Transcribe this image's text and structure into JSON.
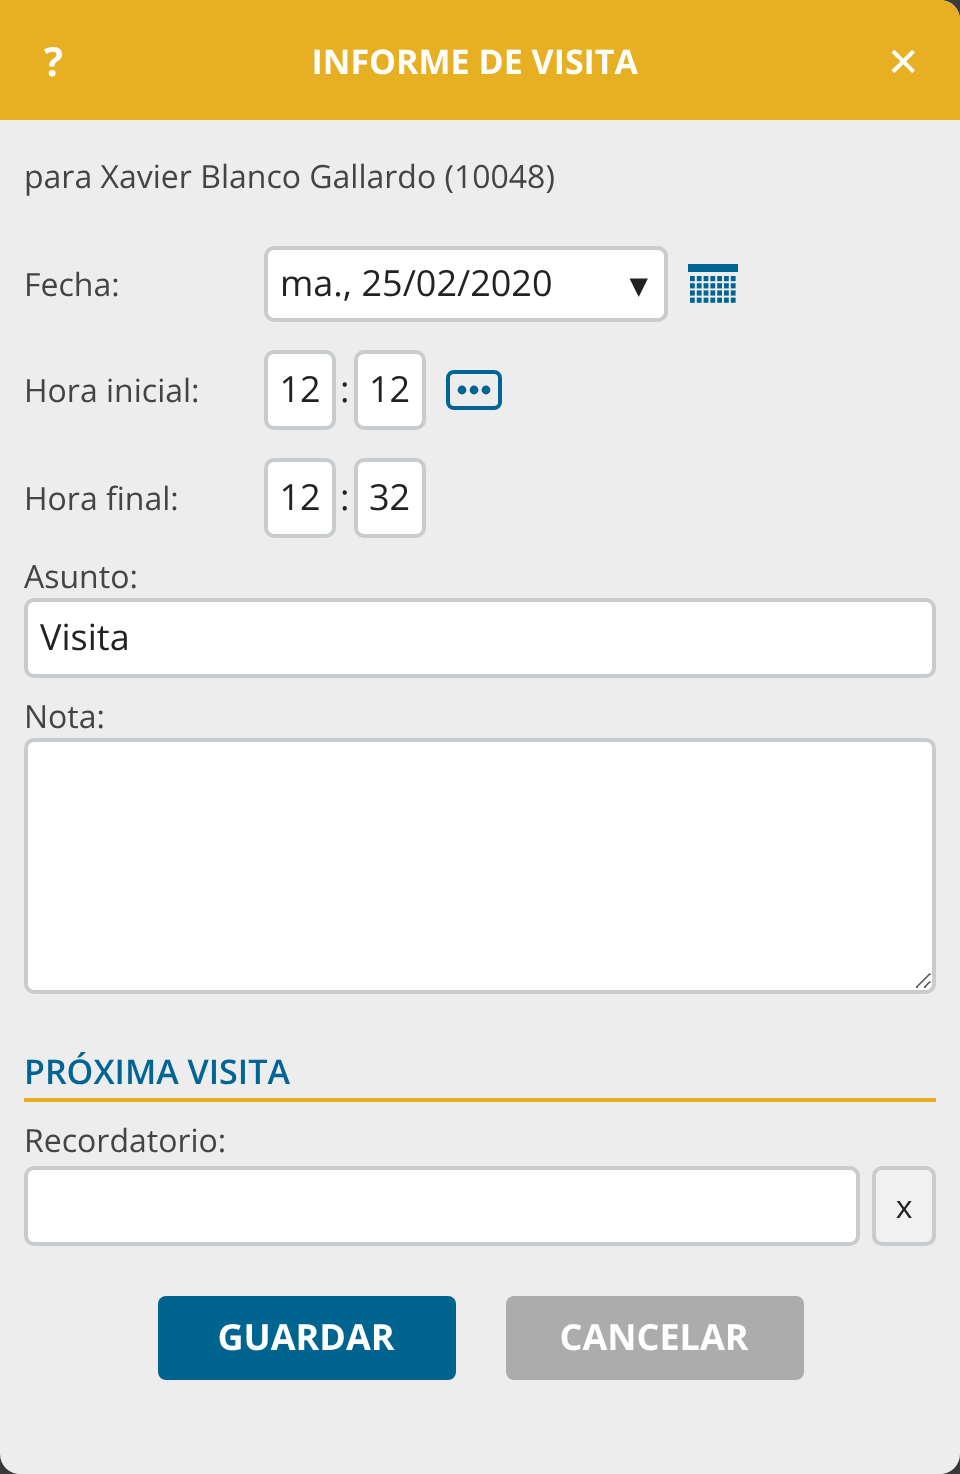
{
  "window": {
    "title": "INFORME DE VISITA",
    "help": "?",
    "close": "✕"
  },
  "subtitle": "para Xavier Blanco Gallardo (10048)",
  "fecha": {
    "label": "Fecha:",
    "value": "ma., 25/02/2020",
    "caret": "▼"
  },
  "hora_inicial": {
    "label": "Hora inicial:",
    "hours": "12",
    "minutes": "12",
    "separator": ":"
  },
  "hora_final": {
    "label": "Hora final:",
    "hours": "12",
    "minutes": "32",
    "separator": ":"
  },
  "asunto": {
    "label": "Asunto:",
    "value": "Visita"
  },
  "nota": {
    "label": "Nota:"
  },
  "section": {
    "title": "PRÓXIMA VISITA"
  },
  "recordatorio": {
    "label": "Recordatorio:",
    "clear": "x"
  },
  "buttons": [
    {
      "label": "GUARDAR",
      "kind": "primary"
    },
    {
      "label": "CANCELAR",
      "kind": "secondary"
    }
  ]
}
